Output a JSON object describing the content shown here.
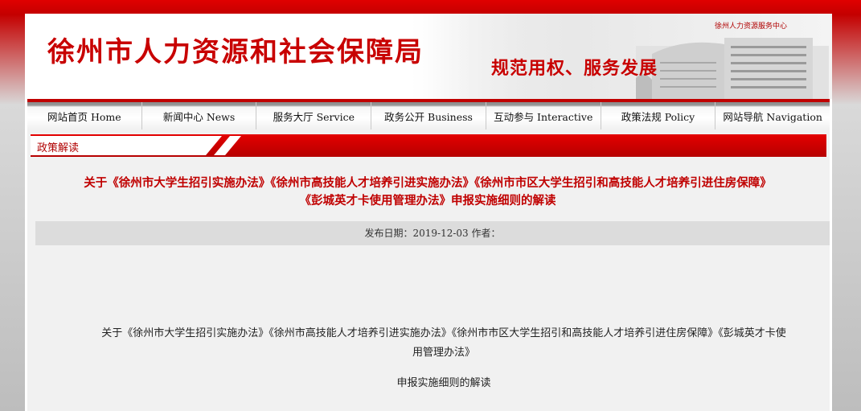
{
  "header": {
    "site_title": "徐州市人力资源和社会保障局",
    "slogan": "规范用权、服务发展",
    "building_sign": "徐州人力资源服务中心"
  },
  "nav": {
    "items": [
      {
        "label": "网站首页 Home"
      },
      {
        "label": "新闻中心 News"
      },
      {
        "label": "服务大厅 Service"
      },
      {
        "label": "政务公开 Business"
      },
      {
        "label": "互动参与 Interactive"
      },
      {
        "label": "政策法规 Policy"
      },
      {
        "label": "网站导航 Navigation"
      }
    ]
  },
  "section": {
    "label": "政策解读"
  },
  "article": {
    "title_line1": "关于《徐州市大学生招引实施办法》《徐州市高技能人才培养引进实施办法》《徐州市市区大学生招引和高技能人才培养引进住房保障》",
    "title_line2": "《彭城英才卡使用管理办法》申报实施细则的解读",
    "meta": "发布日期：2019-12-03    作者：",
    "body_line1": "关于《徐州市大学生招引实施办法》《徐州市高技能人才培养引进实施办法》《徐州市市区大学生招引和高技能人才培养引进住房保障》《彭城英才卡使",
    "body_line2": "用管理办法》",
    "body_line3": "申报实施细则的解读"
  },
  "colors": {
    "brand_red": "#c80000",
    "bar_gray": "#dcdcdc"
  }
}
